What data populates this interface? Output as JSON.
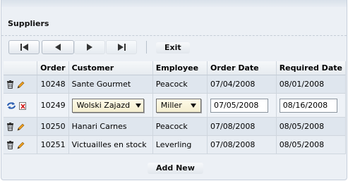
{
  "title": "Suppliers",
  "toolbar": {
    "first_icon": "first-page-icon",
    "prev_icon": "previous-page-icon",
    "next_icon": "next-page-icon",
    "last_icon": "last-page-icon",
    "exit_label": "Exit"
  },
  "grid": {
    "columns": [
      "",
      "Order",
      "Customer",
      "Employee",
      "Order Date",
      "Required Date"
    ],
    "rows": [
      {
        "order": "10248",
        "customer": "Sante Gourmet",
        "employee": "Peacock",
        "order_date": "07/04/2008",
        "required_date": "08/01/2008"
      },
      {
        "order": "10249",
        "customer": "Wolski Zajazd",
        "employee": "Miller",
        "order_date": "07/05/2008",
        "required_date": "08/16/2008",
        "editing": true
      },
      {
        "order": "10250",
        "customer": "Hanari Carnes",
        "employee": "Peacock",
        "order_date": "07/08/2008",
        "required_date": "08/05/2008"
      },
      {
        "order": "10251",
        "customer": "Victuailles en stock",
        "employee": "Leverling",
        "order_date": "07/08/2008",
        "required_date": "08/05/2008"
      }
    ]
  },
  "add_new_label": "Add New",
  "colors": {
    "accent": "#f0a020",
    "panel": "#ecf0f5",
    "row": "#dfe6ee"
  }
}
